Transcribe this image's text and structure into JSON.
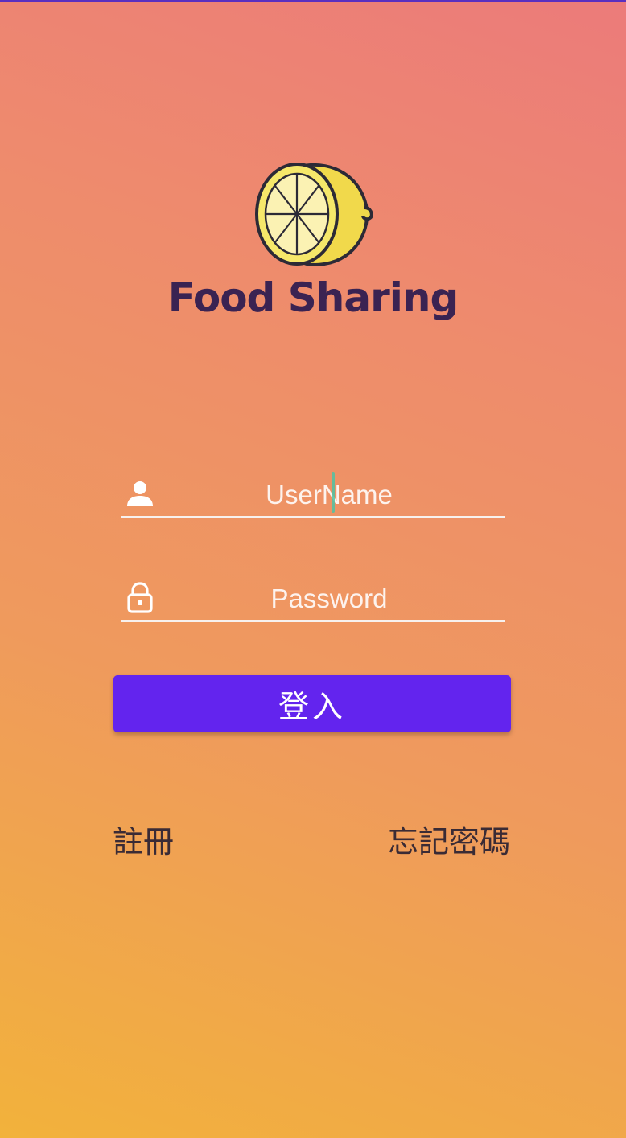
{
  "app": {
    "title": "Food Sharing",
    "logo_icon": "lemon-logo-icon"
  },
  "form": {
    "username": {
      "placeholder": "UserName",
      "value": "",
      "icon": "user-icon"
    },
    "password": {
      "placeholder": "Password",
      "value": "",
      "icon": "lock-icon"
    },
    "login_label": "登入"
  },
  "links": {
    "register_label": "註冊",
    "forgot_password_label": "忘記密碼"
  },
  "colors": {
    "gradient_top": "#ec7b7a",
    "gradient_bottom": "#f2b23b",
    "title": "#3a2352",
    "button": "#6324ee",
    "link": "#3a2b35",
    "input_line": "#f7f1ee",
    "caret": "#4ec2a3"
  }
}
